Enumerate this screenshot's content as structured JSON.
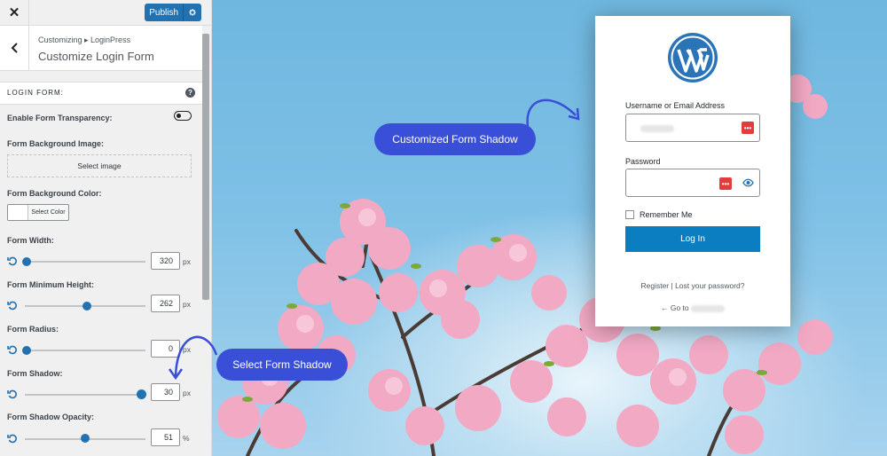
{
  "topbar": {
    "close_glyph": "✕",
    "publish_label": "Publish"
  },
  "header": {
    "breadcrumb": "Customizing ▸ LoginPress",
    "title": "Customize Login Form"
  },
  "section": {
    "title": "LOGIN FORM:",
    "help_glyph": "?"
  },
  "fields": {
    "transparency_label": "Enable Form Transparency:",
    "bg_image_label": "Form Background Image:",
    "select_image": "Select image",
    "bg_color_label": "Form Background Color:",
    "select_color": "Select Color"
  },
  "sliders": [
    {
      "label": "Form Width:",
      "value": "320",
      "unit": "px",
      "position": 0.0
    },
    {
      "label": "Form Minimum Height:",
      "value": "262",
      "unit": "px",
      "position": 0.5
    },
    {
      "label": "Form Radius:",
      "value": "0",
      "unit": "px",
      "position": 0.0
    },
    {
      "label": "Form Shadow:",
      "value": "30",
      "unit": "px",
      "position": 1.0
    },
    {
      "label": "Form Shadow Opacity:",
      "value": "51",
      "unit": "%",
      "position": 0.51
    }
  ],
  "login": {
    "username_label": "Username or Email Address",
    "password_label": "Password",
    "remember": "Remember Me",
    "button": "Log In",
    "links": "Register | Lost your password?",
    "goto": "← Go to"
  },
  "callouts": {
    "customized": "Customized Form Shadow",
    "select": "Select Form Shadow"
  },
  "colors": {
    "accent": "#2271b1",
    "callout": "#3a4fd8",
    "login_button": "#0a7ec0"
  }
}
